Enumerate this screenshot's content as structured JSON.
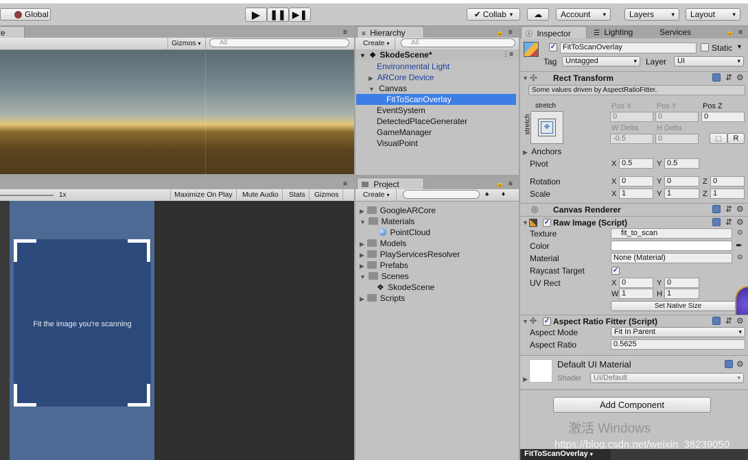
{
  "top": {
    "global_label": "Global",
    "collab_label": "Collab",
    "account_label": "Account",
    "layers_label": "Layers",
    "layout_label": "Layout",
    "play_icon": "play-icon",
    "pause_icon": "pause-icon",
    "step_icon": "step-icon"
  },
  "scene": {
    "tab_partial": "re",
    "gizmos_label": "Gizmos",
    "search_placeholder": "All"
  },
  "game": {
    "scale_label": "1x",
    "toolbar": [
      "Maximize On Play",
      "Mute Audio",
      "Stats",
      "Gizmos"
    ],
    "overlay_text": "Fit the image you're scanning"
  },
  "hierarchy": {
    "tab_label": "Hierarchy",
    "create_label": "Create",
    "search_placeholder": "All",
    "scene_name": "SkodeScene*",
    "items": [
      {
        "label": "Environmental Light"
      },
      {
        "label": "ARCore Device"
      },
      {
        "label": "Canvas"
      },
      {
        "label": "FitToScanOverlay"
      },
      {
        "label": "EventSystem"
      },
      {
        "label": "DetectedPlaceGenerater"
      },
      {
        "label": "GameManager"
      },
      {
        "label": "VisualPoint"
      }
    ]
  },
  "project": {
    "tab_label": "Project",
    "create_label": "Create",
    "items": [
      {
        "label": "GoogleARCore"
      },
      {
        "label": "Materials"
      },
      {
        "label": "PointCloud"
      },
      {
        "label": "Models"
      },
      {
        "label": "PlayServicesResolver"
      },
      {
        "label": "Prefabs"
      },
      {
        "label": "Scenes"
      },
      {
        "label": "SkodeScene"
      },
      {
        "label": "Scripts"
      }
    ]
  },
  "inspector": {
    "tabs": [
      "Inspector",
      "Lighting",
      "Services"
    ],
    "object_name": "FitToScanOverlay",
    "static_label": "Static",
    "tag_label": "Tag",
    "tag_value": "Untagged",
    "layer_label": "Layer",
    "layer_value": "UI",
    "rect": {
      "title": "Rect Transform",
      "note": "Some values driven by AspectRatioFitter.",
      "stretch_top": "stretch",
      "stretch_side": "stretch",
      "pos_x_label": "Pos X",
      "pos_y_label": "Pos Y",
      "pos_z_label": "Pos Z",
      "pos_x": "0",
      "pos_y": "0",
      "pos_z": "0",
      "wdelta_label": "W Delta",
      "hdelta_label": "H Delta",
      "wdelta": "-0.5",
      "hdelta": "0",
      "r_label": "R",
      "anchors_label": "Anchors",
      "pivot_label": "Pivot",
      "pivot_x": "0.5",
      "pivot_y": "0.5",
      "rotation_label": "Rotation",
      "rot_x": "0",
      "rot_y": "0",
      "rot_z": "0",
      "scale_label": "Scale",
      "scale_x": "1",
      "scale_y": "1",
      "scale_z": "1",
      "x": "X",
      "y": "Y",
      "z": "Z"
    },
    "canvas_renderer": "Canvas Renderer",
    "raw_image": {
      "title": "Raw Image (Script)",
      "texture_label": "Texture",
      "texture_value": "fit_to_scan",
      "color_label": "Color",
      "material_label": "Material",
      "material_value": "None (Material)",
      "raycast_label": "Raycast Target",
      "uvrect_label": "UV Rect",
      "uv_x": "0",
      "uv_y": "0",
      "uv_w": "1",
      "uv_h": "1",
      "w": "W",
      "h": "H",
      "native_btn": "Set Native Size"
    },
    "aspect": {
      "title": "Aspect Ratio Fitter (Script)",
      "mode_label": "Aspect Mode",
      "mode_value": "Fit In Parent",
      "ratio_label": "Aspect Ratio",
      "ratio_value": "0.5625"
    },
    "material": {
      "name": "Default UI Material",
      "shader_label": "Shader",
      "shader_value": "UI/Default"
    },
    "add_component": "Add Component",
    "watermark": "激活 Windows",
    "watermark2": "https://blog.csdn.net/weixin_38239050",
    "footer_label": "FitToScanOverlay"
  },
  "colors": {
    "selection": "#3d7ee6",
    "game_bg": "#2f2f2f",
    "overlay_panel": "#4d6a94",
    "overlay_inner": "#2c4a7b"
  }
}
